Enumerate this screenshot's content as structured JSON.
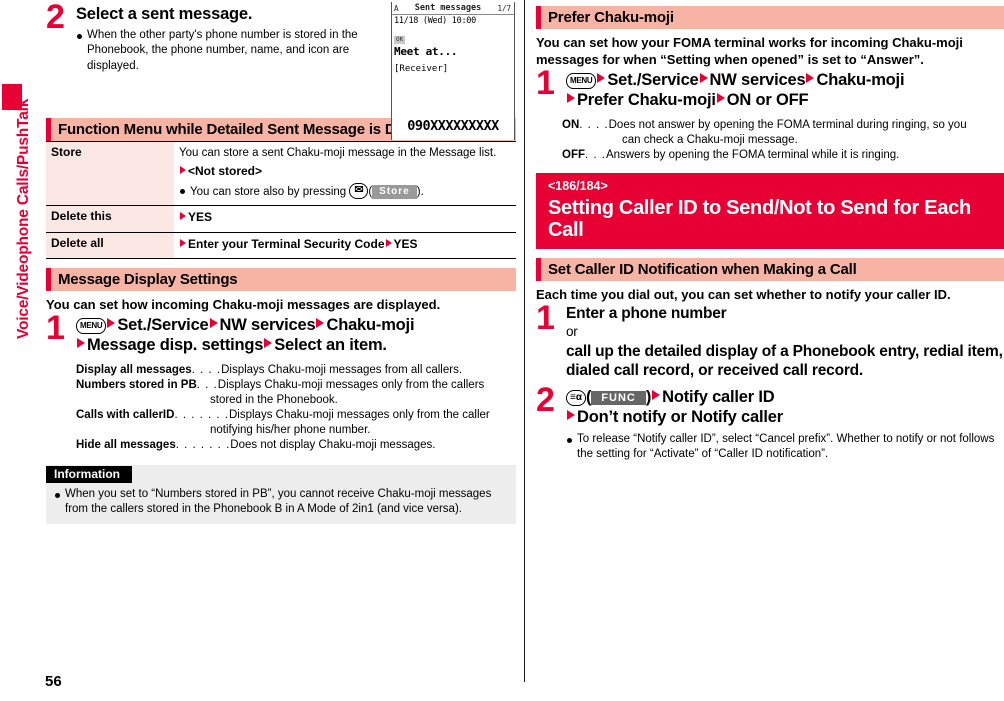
{
  "sidebar": {
    "label": "Voice/Videophone Calls/PushTalk"
  },
  "page": {
    "number": "56"
  },
  "left": {
    "step2": {
      "num": "2",
      "title": "Select a sent message.",
      "bullet": "When the other party's phone number is stored in the Phonebook, the phone number, name, and icon are displayed."
    },
    "phone_screen": {
      "status_left": "A",
      "status_title": "Sent messages",
      "status_right": "1/7",
      "date": "11/18 (Wed) 10:00",
      "icon_label": "OK",
      "message": "Meet at...",
      "receiver": "[Receiver]",
      "number": "090XXXXXXXXX"
    },
    "function_menu": {
      "heading": "Function Menu while Detailed Sent Message is Displayed",
      "rows": [
        {
          "key": "Store",
          "line1": "You can store a sent Chaku-moji message in the Message list.",
          "line2": "<Not stored>",
          "bullet_pre": "You can store also by pressing ",
          "bullet_key": "envelope-key",
          "bullet_soft": "Store",
          "bullet_post": ")."
        },
        {
          "key": "Delete this",
          "value": "YES"
        },
        {
          "key": "Delete all",
          "value": "Enter your Terminal Security Code",
          "value2": "YES"
        }
      ]
    },
    "message_display": {
      "heading": "Message Display Settings",
      "lead": "You can set how incoming Chaku-moji messages are displayed.",
      "step": {
        "num": "1",
        "key": "MENU",
        "line1": [
          "Set./Service",
          "NW services",
          "Chaku-moji"
        ],
        "line2": [
          "Message disp. settings",
          "Select an item."
        ]
      },
      "items": [
        {
          "term": "Display all messages",
          "dots": ". . . .",
          "desc": "Displays Chaku-moji messages from all callers."
        },
        {
          "term": "Numbers stored in PB",
          "dots": ". . .",
          "desc": "Displays Chaku-moji messages only from the callers",
          "desc2": "stored in the Phonebook."
        },
        {
          "term": "Calls with callerID",
          "dots": ". . . . . . .",
          "desc": "Displays Chaku-moji messages only from the caller",
          "desc2": "notifying his/her phone number."
        },
        {
          "term": "Hide all messages",
          "dots": ". . . . . . .",
          "desc": "Does not display Chaku-moji messages."
        }
      ]
    },
    "information": {
      "heading": "Information",
      "bullet": "When you set to “Numbers stored in PB”, you cannot receive Chaku-moji messages from the callers stored in the Phonebook B in A Mode of 2in1 (and vice versa)."
    }
  },
  "right": {
    "prefer": {
      "heading": "Prefer Chaku-moji",
      "lead": "You can set how your FOMA terminal works for incoming Chaku-moji messages for when “Setting when opened” is set to “Answer”.",
      "step": {
        "num": "1",
        "key": "MENU",
        "line1": [
          "Set./Service",
          "NW services",
          "Chaku-moji"
        ],
        "line2": [
          "Prefer Chaku-moji",
          "ON or OFF"
        ]
      },
      "items": [
        {
          "term": "ON",
          "dots": ". . . .",
          "desc": "Does not answer by opening the FOMA terminal during ringing, so you",
          "desc2": "can check a Chaku-moji message."
        },
        {
          "term": "OFF",
          "dots": ". . .",
          "desc": "Answers by opening the FOMA terminal while it is ringing."
        }
      ]
    },
    "red_section": {
      "code": "<186/184>",
      "title": "Setting Caller ID to Send/Not to Send for Each Call"
    },
    "caller_id": {
      "heading": "Set Caller ID Notification when Making a Call",
      "lead": "Each time you dial out, you can set whether to notify your caller ID.",
      "step1": {
        "num": "1",
        "line1": "Enter a phone number",
        "line2": "or",
        "line3": "call up the detailed display of a Phonebook entry, redial item, dialed call record, or received call record."
      },
      "step2": {
        "num": "2",
        "key": "imode-func-key",
        "softkey": "FUNC",
        "line1": "Notify caller ID",
        "line2": "Don’t notify or Notify caller",
        "bullet": "To release “Notify caller ID”, select “Cancel prefix”. Whether to notify or not follows the setting for “Activate” of “Caller ID notification”."
      }
    }
  },
  "colors": {
    "accent_red": "#e60033",
    "bar_pink": "#f7b3a4",
    "table_key_bg": "#fbe7e3",
    "info_bg": "#ededed"
  }
}
